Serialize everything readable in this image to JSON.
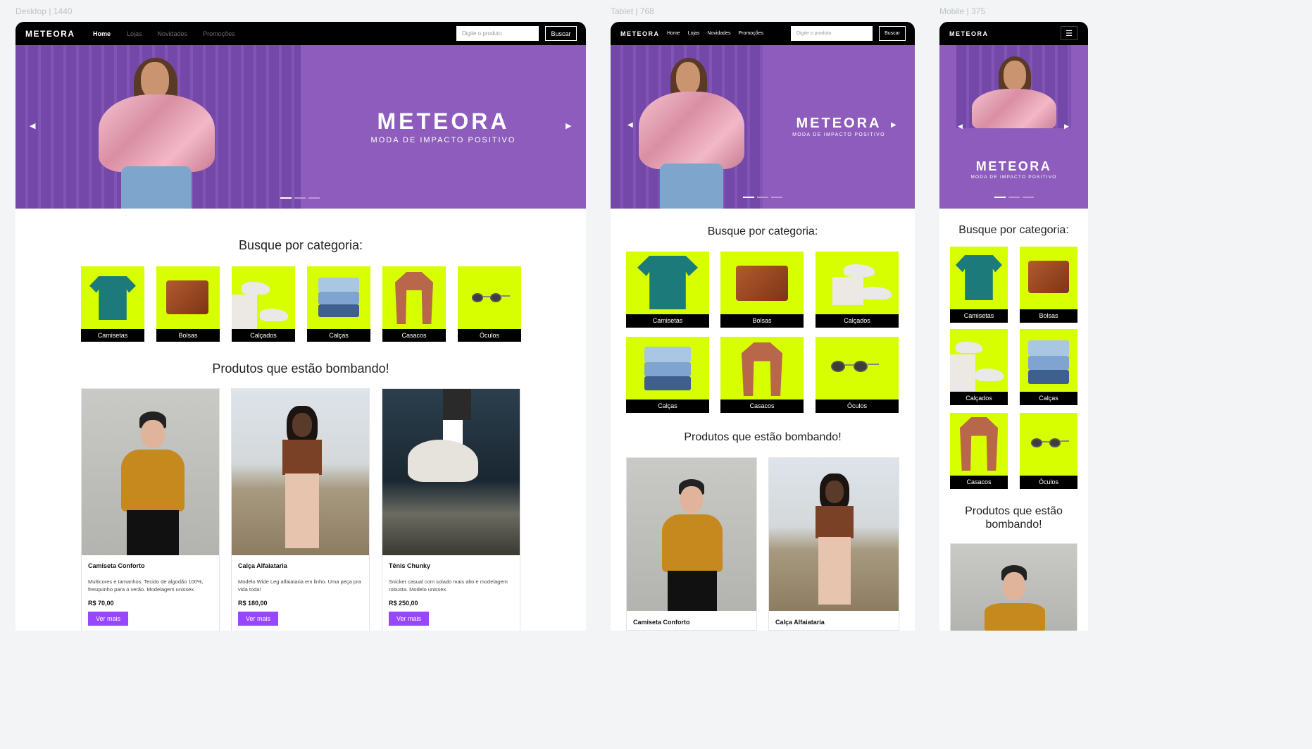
{
  "labels": {
    "desktop": "Desktop | 1440",
    "tablet": "Tablet | 768",
    "mobile": "Mobile | 375"
  },
  "nav": {
    "logo": "METEORA",
    "links": [
      "Home",
      "Lojas",
      "Novidades",
      "Promoções"
    ],
    "search_placeholder": "Digite o produto",
    "search_button": "Buscar"
  },
  "hero": {
    "brand": "METEORA",
    "tagline": "MODA DE IMPACTO POSITIVO",
    "prev": "◀",
    "next": "▶"
  },
  "categories": {
    "title": "Busque por categoria:",
    "items": [
      "Camisetas",
      "Bolsas",
      "Calçados",
      "Calças",
      "Casacos",
      "Óculos"
    ]
  },
  "products": {
    "title": "Produtos que estão bombando!",
    "items": [
      {
        "name": "Camiseta Conforto",
        "desc": "Multicores e tamanhos. Tecido de algodão 100%, fresquinho para o verão. Modelagem unissex.",
        "price": "R$ 70,00",
        "button": "Ver mais"
      },
      {
        "name": "Calça Alfaiataria",
        "desc": "Modelo Wide Leg alfaiataria em linho. Uma peça pra vida toda!",
        "price": "R$ 180,00",
        "button": "Ver mais"
      },
      {
        "name": "Tênis Chunky",
        "desc": "Snicker casual com solado mais alto e modelagem robusta. Modelo unissex.",
        "price": "R$ 250,00",
        "button": "Ver mais"
      }
    ]
  },
  "mobile": {
    "menu_icon": "☰",
    "products_title_line1": "Produtos que estão",
    "products_title_line2": "bombando!"
  },
  "colors": {
    "accent": "#9747ff",
    "lime": "#d8ff00",
    "purple": "#8e5cbc",
    "black": "#000000"
  }
}
